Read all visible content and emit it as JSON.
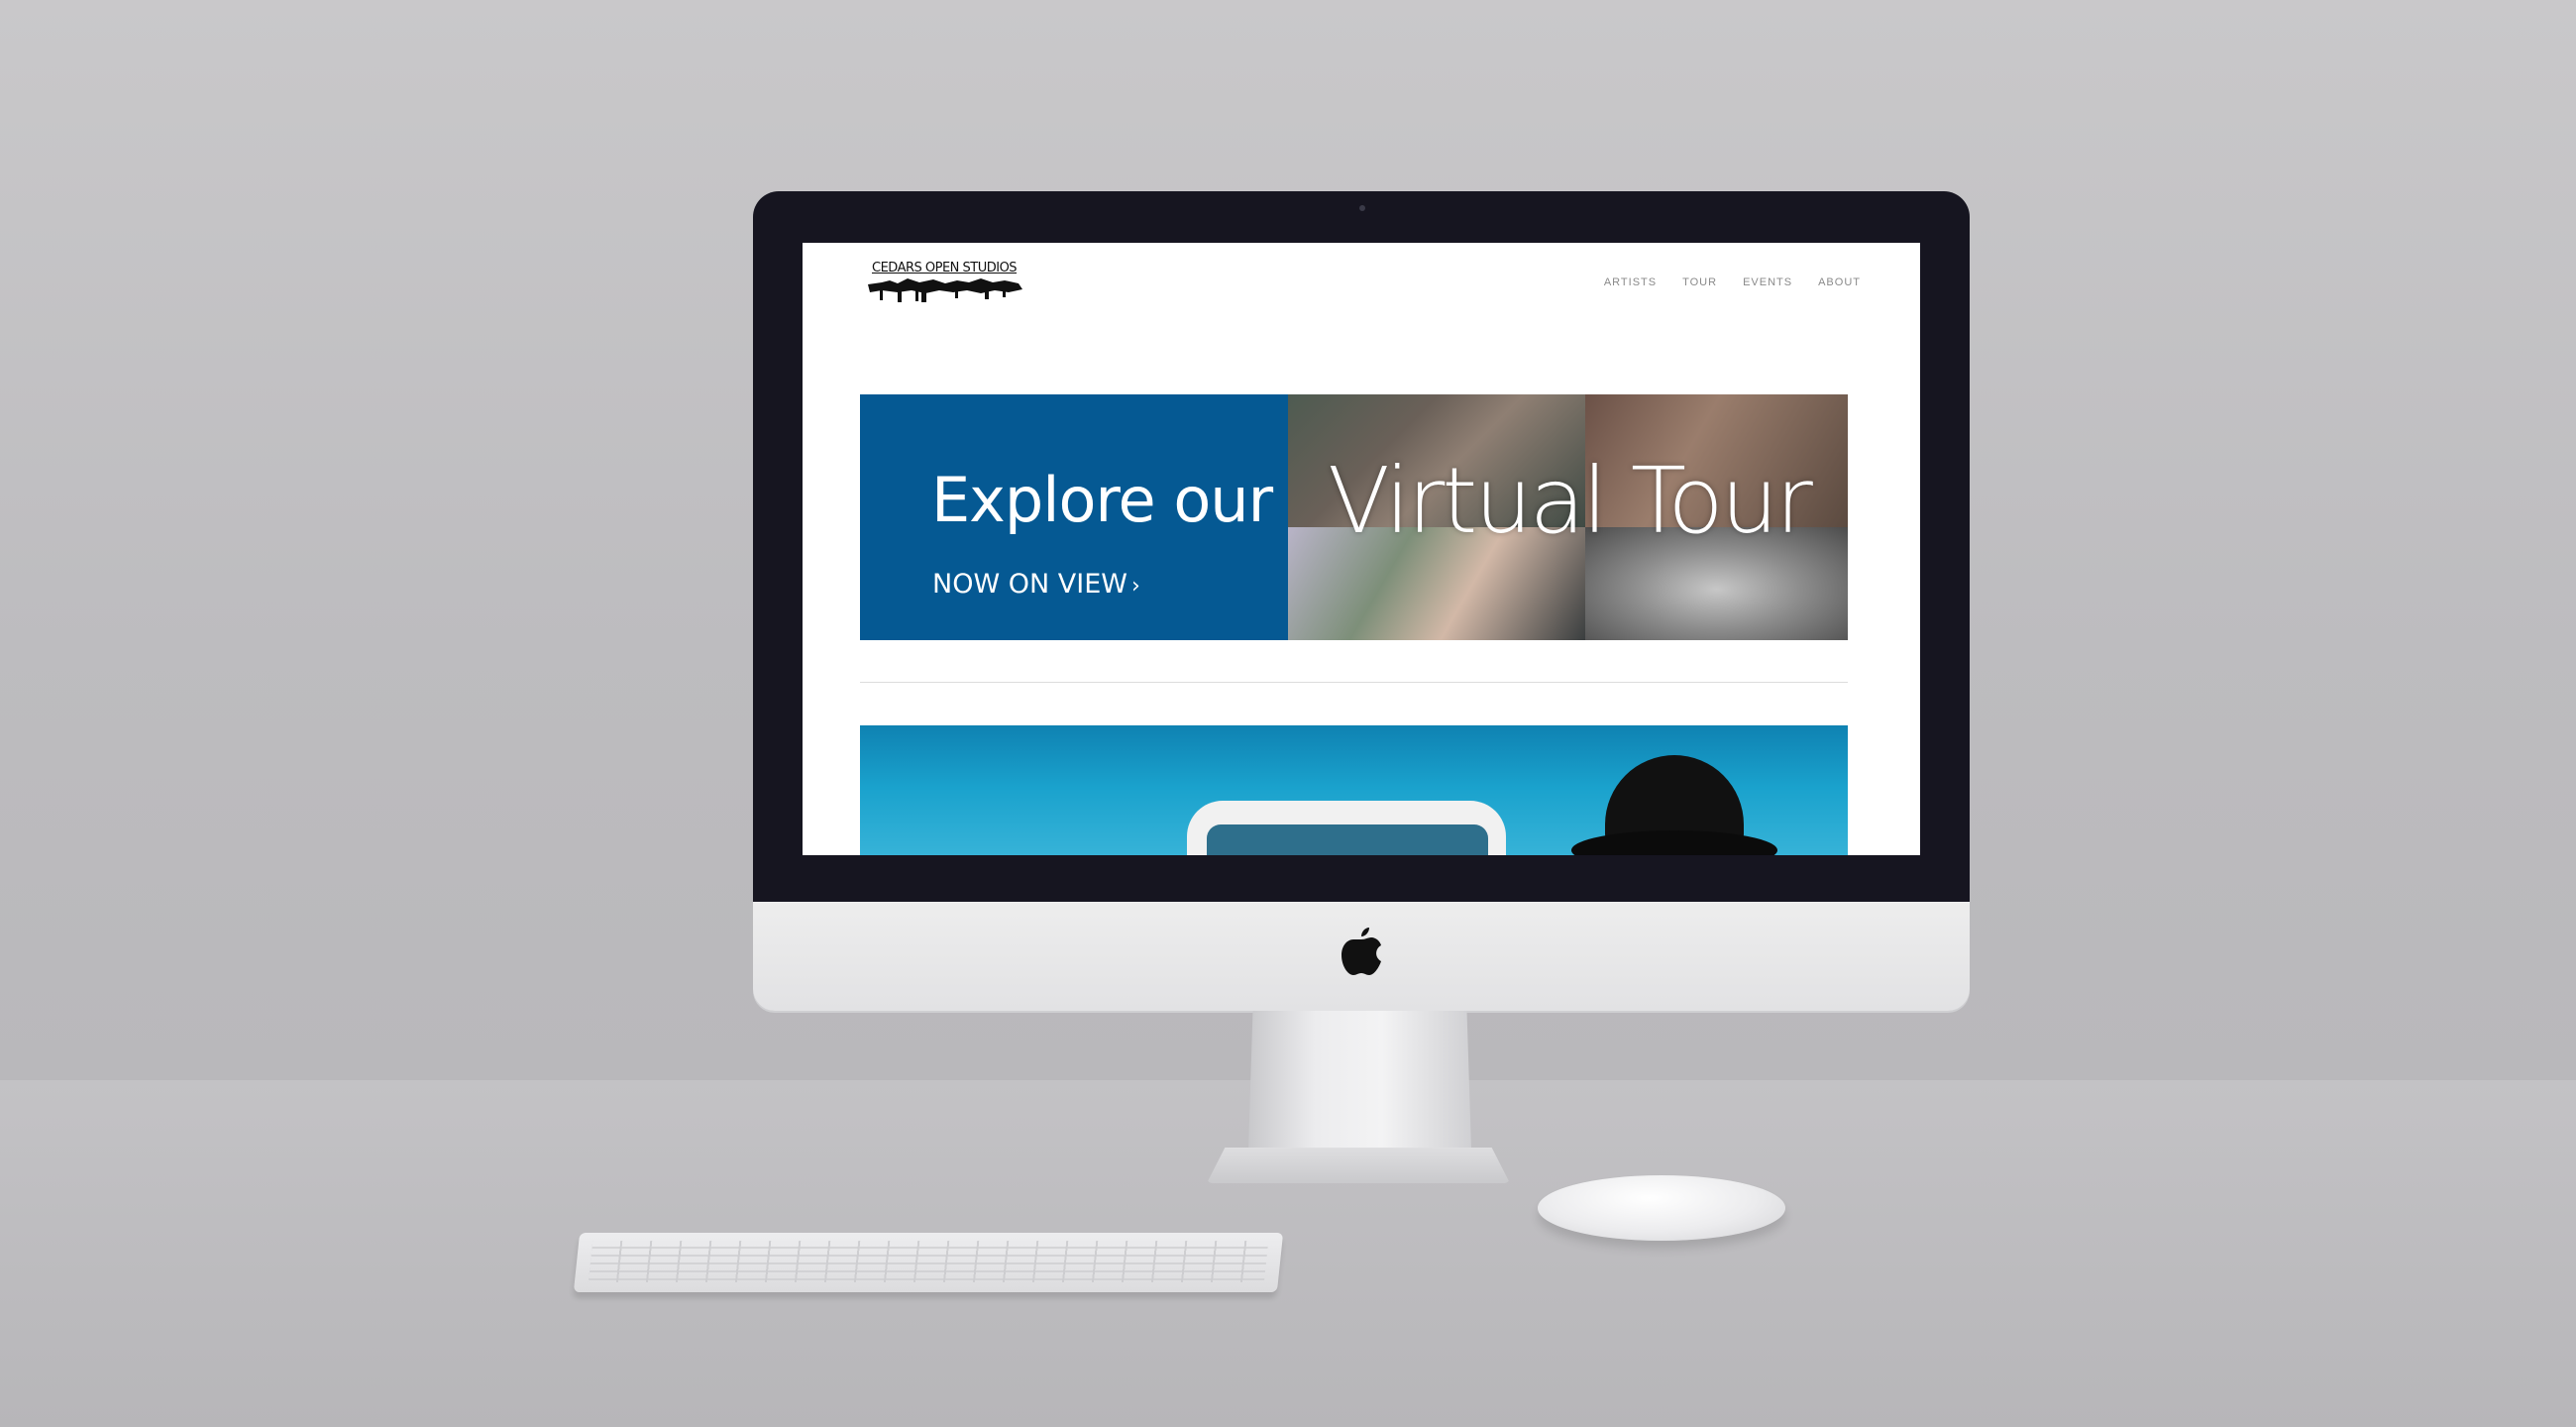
{
  "site": {
    "logo_text": "CEDARS OPEN STUDIOS",
    "nav": [
      {
        "label": "ARTISTS"
      },
      {
        "label": "TOUR"
      },
      {
        "label": "EVENTS"
      },
      {
        "label": "ABOUT"
      }
    ]
  },
  "banner": {
    "heading": "Explore our",
    "subheading": "NOW ON VIEW",
    "chevron": "›",
    "collage_title": "Virtual Tour",
    "background_color": "#055993"
  },
  "icons": {
    "apple": "apple-logo-icon"
  }
}
